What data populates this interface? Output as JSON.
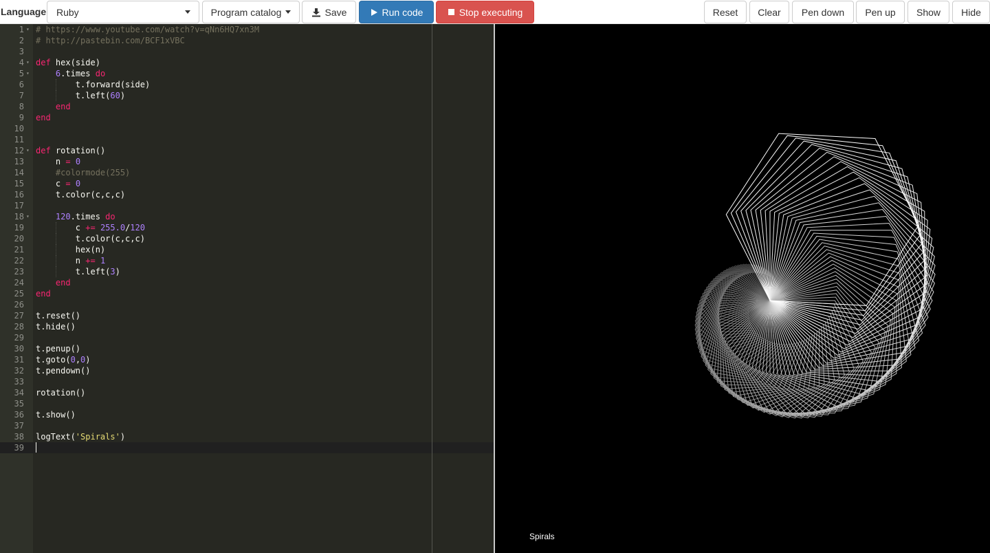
{
  "toolbar": {
    "language_label": "Language",
    "language_value": "Ruby",
    "catalog_label": "Program catalog",
    "save_label": "Save",
    "run_label": "Run code",
    "stop_label": "Stop executing",
    "reset_label": "Reset",
    "clear_label": "Clear",
    "pen_down_label": "Pen down",
    "pen_up_label": "Pen up",
    "show_label": "Show",
    "hide_label": "Hide"
  },
  "colors": {
    "editor_bg": "#272822",
    "gutter_bg": "#2f3129",
    "keyword": "#f92672",
    "number": "#ae81ff",
    "comment": "#75715e",
    "string": "#e6db74",
    "run_button": "#337ab7",
    "stop_button": "#d9534f",
    "canvas_bg": "#000000"
  },
  "editor": {
    "active_line": 39,
    "lines": [
      {
        "n": 1,
        "fold": true,
        "tokens": [
          [
            "c",
            "# https://www.youtube.com/watch?v=qNn6HQ7xn3M"
          ]
        ]
      },
      {
        "n": 2,
        "fold": false,
        "tokens": [
          [
            "c",
            "# http://pastebin.com/BCF1xVBC"
          ]
        ]
      },
      {
        "n": 3,
        "fold": false,
        "tokens": []
      },
      {
        "n": 4,
        "fold": true,
        "tokens": [
          [
            "k",
            "def"
          ],
          [
            "p",
            " "
          ],
          [
            "f",
            "hex(side)"
          ]
        ]
      },
      {
        "n": 5,
        "fold": true,
        "tokens": [
          [
            "p",
            "    "
          ],
          [
            "n",
            "6"
          ],
          [
            "p",
            ".times "
          ],
          [
            "k",
            "do"
          ]
        ]
      },
      {
        "n": 6,
        "fold": false,
        "tokens": [
          [
            "p",
            "        t.forward(side)"
          ]
        ]
      },
      {
        "n": 7,
        "fold": false,
        "tokens": [
          [
            "p",
            "        t.left("
          ],
          [
            "n",
            "60"
          ],
          [
            "p",
            ")"
          ]
        ]
      },
      {
        "n": 8,
        "fold": false,
        "tokens": [
          [
            "p",
            "    "
          ],
          [
            "k",
            "end"
          ]
        ]
      },
      {
        "n": 9,
        "fold": false,
        "tokens": [
          [
            "k",
            "end"
          ]
        ]
      },
      {
        "n": 10,
        "fold": false,
        "tokens": []
      },
      {
        "n": 11,
        "fold": false,
        "tokens": []
      },
      {
        "n": 12,
        "fold": true,
        "tokens": [
          [
            "k",
            "def"
          ],
          [
            "p",
            " "
          ],
          [
            "f",
            "rotation()"
          ]
        ]
      },
      {
        "n": 13,
        "fold": false,
        "tokens": [
          [
            "p",
            "    n "
          ],
          [
            "k",
            "="
          ],
          [
            "p",
            " "
          ],
          [
            "n",
            "0"
          ]
        ]
      },
      {
        "n": 14,
        "fold": false,
        "tokens": [
          [
            "p",
            "    "
          ],
          [
            "c",
            "#colormode(255)"
          ]
        ]
      },
      {
        "n": 15,
        "fold": false,
        "tokens": [
          [
            "p",
            "    c "
          ],
          [
            "k",
            "="
          ],
          [
            "p",
            " "
          ],
          [
            "n",
            "0"
          ]
        ]
      },
      {
        "n": 16,
        "fold": false,
        "tokens": [
          [
            "p",
            "    t.color(c,c,c)"
          ]
        ]
      },
      {
        "n": 17,
        "fold": false,
        "tokens": []
      },
      {
        "n": 18,
        "fold": true,
        "tokens": [
          [
            "p",
            "    "
          ],
          [
            "n",
            "120"
          ],
          [
            "p",
            ".times "
          ],
          [
            "k",
            "do"
          ]
        ]
      },
      {
        "n": 19,
        "fold": false,
        "tokens": [
          [
            "p",
            "        c "
          ],
          [
            "k",
            "+="
          ],
          [
            "p",
            " "
          ],
          [
            "n",
            "255.0"
          ],
          [
            "p",
            "/"
          ],
          [
            "n",
            "120"
          ]
        ]
      },
      {
        "n": 20,
        "fold": false,
        "tokens": [
          [
            "p",
            "        t.color(c,c,c)"
          ]
        ]
      },
      {
        "n": 21,
        "fold": false,
        "tokens": [
          [
            "p",
            "        hex(n)"
          ]
        ]
      },
      {
        "n": 22,
        "fold": false,
        "tokens": [
          [
            "p",
            "        n "
          ],
          [
            "k",
            "+="
          ],
          [
            "p",
            " "
          ],
          [
            "n",
            "1"
          ]
        ]
      },
      {
        "n": 23,
        "fold": false,
        "tokens": [
          [
            "p",
            "        t.left("
          ],
          [
            "n",
            "3"
          ],
          [
            "p",
            ")"
          ]
        ]
      },
      {
        "n": 24,
        "fold": false,
        "tokens": [
          [
            "p",
            "    "
          ],
          [
            "k",
            "end"
          ]
        ]
      },
      {
        "n": 25,
        "fold": false,
        "tokens": [
          [
            "k",
            "end"
          ]
        ]
      },
      {
        "n": 26,
        "fold": false,
        "tokens": []
      },
      {
        "n": 27,
        "fold": false,
        "tokens": [
          [
            "p",
            "t.reset()"
          ]
        ]
      },
      {
        "n": 28,
        "fold": false,
        "tokens": [
          [
            "p",
            "t.hide()"
          ]
        ]
      },
      {
        "n": 29,
        "fold": false,
        "tokens": []
      },
      {
        "n": 30,
        "fold": false,
        "tokens": [
          [
            "p",
            "t.penup()"
          ]
        ]
      },
      {
        "n": 31,
        "fold": false,
        "tokens": [
          [
            "p",
            "t.goto("
          ],
          [
            "n",
            "0"
          ],
          [
            "p",
            ","
          ],
          [
            "n",
            "0"
          ],
          [
            "p",
            ")"
          ]
        ]
      },
      {
        "n": 32,
        "fold": false,
        "tokens": [
          [
            "p",
            "t.pendown()"
          ]
        ]
      },
      {
        "n": 33,
        "fold": false,
        "tokens": []
      },
      {
        "n": 34,
        "fold": false,
        "tokens": [
          [
            "p",
            "rotation()"
          ]
        ]
      },
      {
        "n": 35,
        "fold": false,
        "tokens": []
      },
      {
        "n": 36,
        "fold": false,
        "tokens": [
          [
            "p",
            "t.show()"
          ]
        ]
      },
      {
        "n": 37,
        "fold": false,
        "tokens": []
      },
      {
        "n": 38,
        "fold": false,
        "tokens": [
          [
            "p",
            "logText("
          ],
          [
            "s",
            "'Spirals'"
          ],
          [
            "p",
            ")"
          ]
        ]
      },
      {
        "n": 39,
        "fold": false,
        "tokens": []
      }
    ]
  },
  "canvas": {
    "log_text": "Spirals",
    "drawing": {
      "hexagon_count": 120,
      "turn_per_hexagon_deg": 3,
      "hexagon_turn_deg": 60,
      "side_step": 1
    }
  }
}
